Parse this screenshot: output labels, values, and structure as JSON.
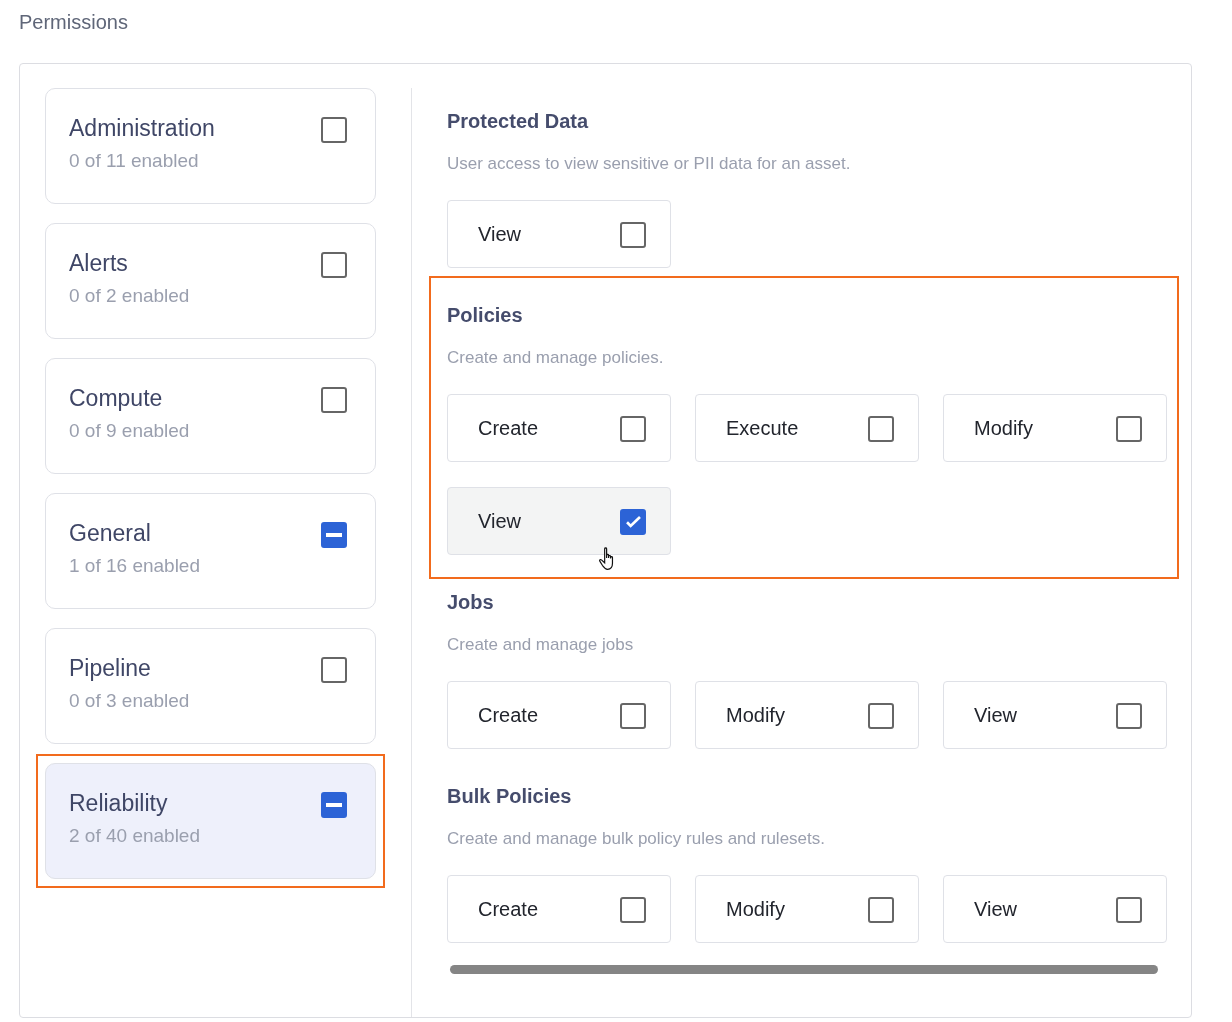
{
  "title": "Permissions",
  "categories": [
    {
      "name": "Administration",
      "summary": "0 of 11 enabled",
      "indeterminate": false,
      "selected": false,
      "highlighted": false
    },
    {
      "name": "Alerts",
      "summary": "0 of 2 enabled",
      "indeterminate": false,
      "selected": false,
      "highlighted": false
    },
    {
      "name": "Compute",
      "summary": "0 of 9 enabled",
      "indeterminate": false,
      "selected": false,
      "highlighted": false
    },
    {
      "name": "General",
      "summary": "1 of 16 enabled",
      "indeterminate": true,
      "selected": false,
      "highlighted": false
    },
    {
      "name": "Pipeline",
      "summary": "0 of 3 enabled",
      "indeterminate": false,
      "selected": false,
      "highlighted": false
    },
    {
      "name": "Reliability",
      "summary": "2 of 40 enabled",
      "indeterminate": true,
      "selected": true,
      "highlighted": true
    }
  ],
  "sections": [
    {
      "heading": "Protected Data",
      "description": "User access to view sensitive or PII data for an asset.",
      "highlighted": false,
      "options": [
        {
          "label": "View",
          "checked": false,
          "hovered": false
        }
      ]
    },
    {
      "heading": "Policies",
      "description": "Create and manage policies.",
      "highlighted": true,
      "options": [
        {
          "label": "Create",
          "checked": false,
          "hovered": false
        },
        {
          "label": "Execute",
          "checked": false,
          "hovered": false
        },
        {
          "label": "Modify",
          "checked": false,
          "hovered": false
        },
        {
          "label": "View",
          "checked": true,
          "hovered": true
        }
      ]
    },
    {
      "heading": "Jobs",
      "description": "Create and manage jobs",
      "highlighted": false,
      "options": [
        {
          "label": "Create",
          "checked": false,
          "hovered": false
        },
        {
          "label": "Modify",
          "checked": false,
          "hovered": false
        },
        {
          "label": "View",
          "checked": false,
          "hovered": false
        }
      ]
    },
    {
      "heading": "Bulk Policies",
      "description": "Create and manage bulk policy rules and rulesets.",
      "highlighted": false,
      "options": [
        {
          "label": "Create",
          "checked": false,
          "hovered": false
        },
        {
          "label": "Modify",
          "checked": false,
          "hovered": false
        },
        {
          "label": "View",
          "checked": false,
          "hovered": false
        }
      ]
    }
  ]
}
